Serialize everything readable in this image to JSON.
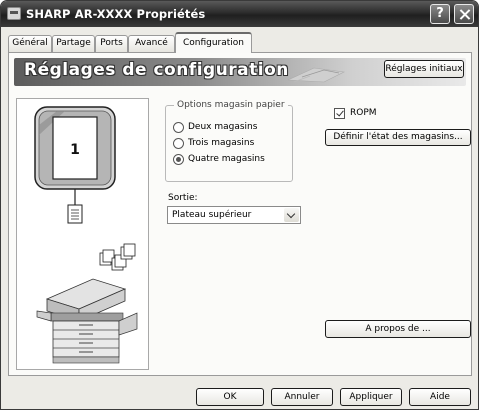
{
  "window": {
    "title": "SHARP AR-XXXX Propriétés",
    "help_button": "?",
    "close_button": "close"
  },
  "tabs": [
    {
      "label": "Général"
    },
    {
      "label": "Partage"
    },
    {
      "label": "Ports"
    },
    {
      "label": "Avancé"
    },
    {
      "label": "Configuration",
      "active": true
    }
  ],
  "banner": {
    "heading": "Réglages de configuration",
    "initial_button": "Réglages initiaux"
  },
  "illustration": {
    "tray_number": "1"
  },
  "paper_tray_options": {
    "legend": "Options magasin papier",
    "options": [
      {
        "label": "Deux magasins",
        "selected": false
      },
      {
        "label": "Trois magasins",
        "selected": false
      },
      {
        "label": "Quatre magasins",
        "selected": true
      }
    ]
  },
  "output": {
    "label": "Sortie:",
    "selected": "Plateau supérieur"
  },
  "ropm": {
    "label": "ROPM",
    "checked": true
  },
  "define_tray_button": "Définir l'état des magasins...",
  "about_button": "A propos de ...",
  "footer": {
    "ok": "OK",
    "cancel": "Annuler",
    "apply": "Appliquer",
    "help": "Aide"
  }
}
